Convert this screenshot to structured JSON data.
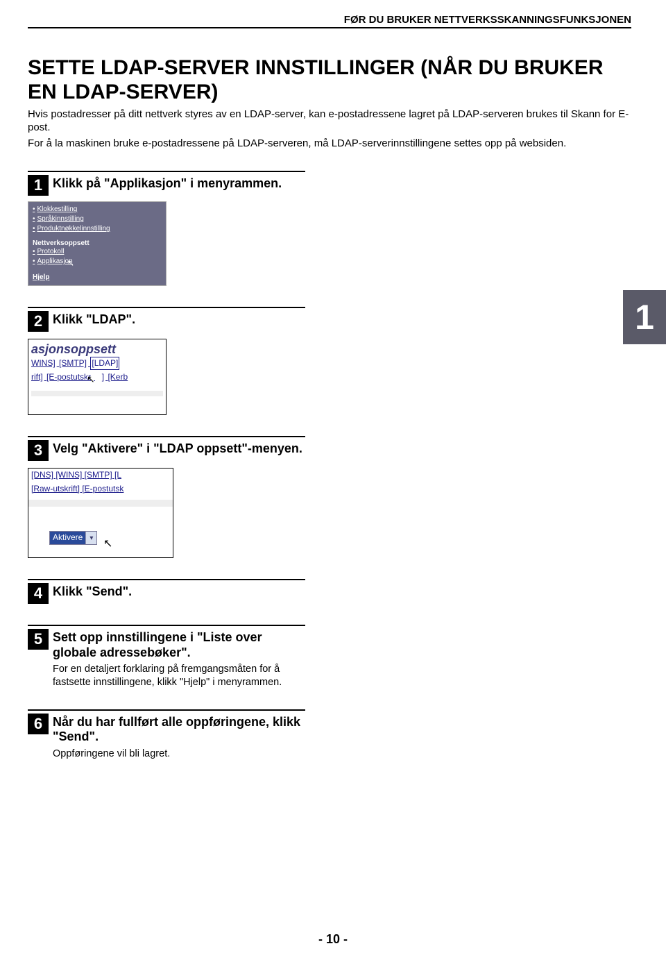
{
  "header": "FØR DU BRUKER NETTVERKSSKANNINGSFUNKSJONEN",
  "title": "SETTE LDAP-SERVER INNSTILLINGER (NÅR DU BRUKER EN LDAP-SERVER)",
  "intro1": "Hvis postadresser på ditt nettverk styres av en LDAP-server, kan e-postadressene lagret på LDAP-serveren brukes til Skann for E-post.",
  "intro2": "For å la maskinen bruke e-postadressene på LDAP-serveren, må LDAP-serverinnstillingene settes opp på websiden.",
  "chapter": "1",
  "steps": {
    "s1": {
      "num": "1",
      "text": "Klikk på \"Applikasjon\" i menyrammen."
    },
    "s2": {
      "num": "2",
      "text": "Klikk \"LDAP\"."
    },
    "s3": {
      "num": "3",
      "text": "Velg \"Aktivere\" i \"LDAP oppsett\"-menyen."
    },
    "s4": {
      "num": "4",
      "text": "Klikk \"Send\"."
    },
    "s5": {
      "num": "5",
      "text": "Sett opp innstillingene i \"Liste over globale adressebøker\".",
      "sub": "For en detaljert forklaring på fremgangsmåten for å fastsette innstillingene, klikk \"Hjelp\" i menyrammen."
    },
    "s6": {
      "num": "6",
      "text": "Når du har fullført alle oppføringene, klikk \"Send\".",
      "sub": "Oppføringene vil bli lagret."
    }
  },
  "shot1": {
    "i1": "Klokkestilling",
    "i2": "Språkinnstilling",
    "i3": "Produktnøkkelinnstilling",
    "sec": "Nettverksoppsett",
    "i4": "Protokoll",
    "i5": "Applikasjon",
    "help": "Hjelp"
  },
  "shot2": {
    "title": "asjonsoppsett",
    "l1a": "WINS]",
    "l1b": "[SMTP]",
    "l1c": "[LDAP]",
    "l2a": "rift]",
    "l2b": "[E-postutskr",
    "l2c": "]",
    "l2d": "[Kerb"
  },
  "shot3": {
    "l1": "[DNS] [WINS] [SMTP] [L",
    "l2": "[Raw-utskrift] [E-postutsk",
    "dropdown": "Aktivere"
  },
  "pagenum": "- 10 -"
}
